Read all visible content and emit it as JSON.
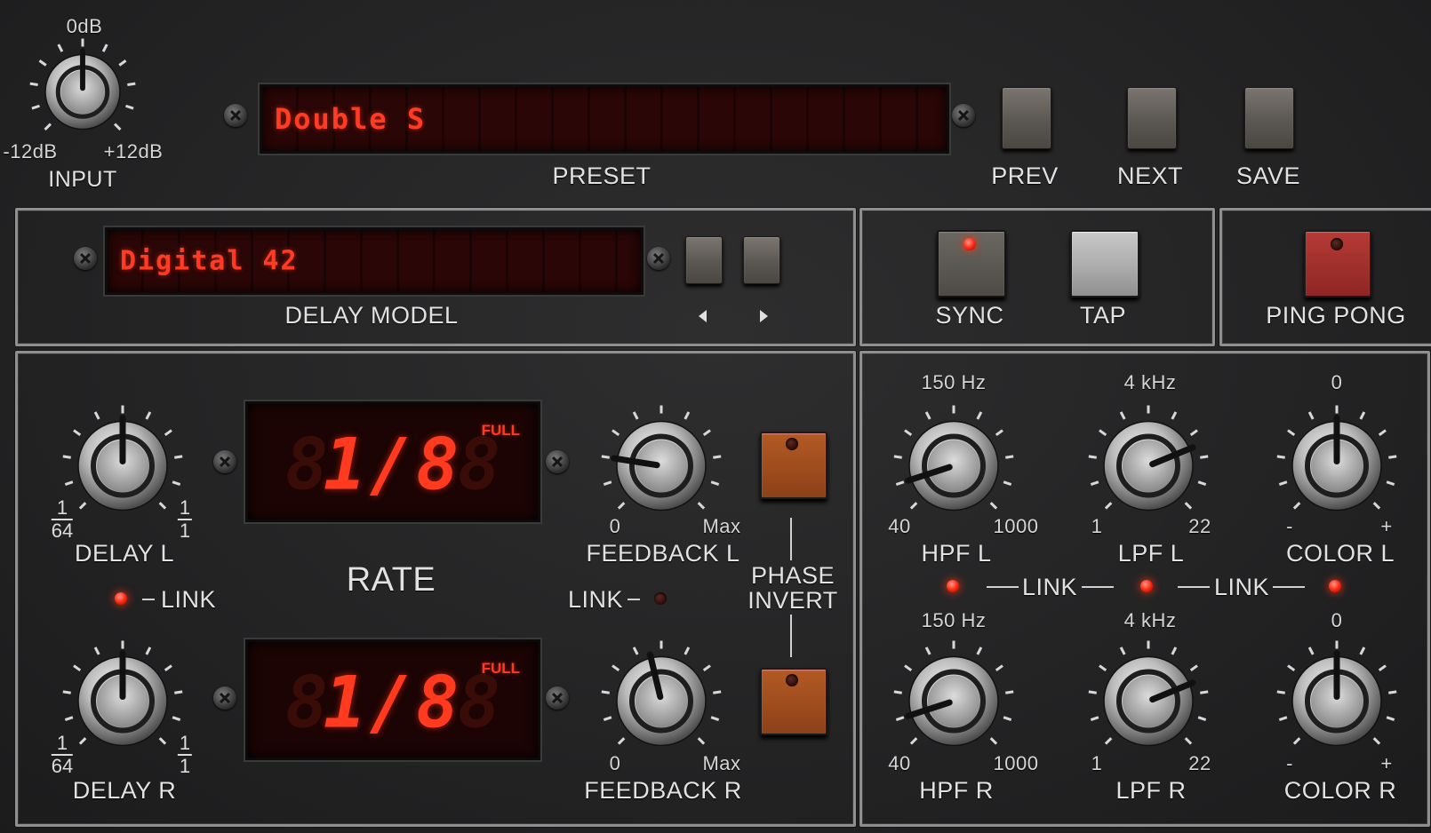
{
  "header": {
    "input": {
      "label": "INPUT",
      "top": "0dB",
      "min": "-12dB",
      "max": "+12dB",
      "value_fraction": 0.5
    },
    "preset": {
      "label": "PRESET",
      "value": "Double S"
    },
    "buttons": {
      "prev": "PREV",
      "next": "NEXT",
      "save": "SAVE"
    }
  },
  "model_section": {
    "label": "DELAY MODEL",
    "value": "Digital 42",
    "prev_arrow": "◀",
    "next_arrow": "▶"
  },
  "sync_section": {
    "sync": {
      "label": "SYNC",
      "led": "on"
    },
    "tap": {
      "label": "TAP"
    },
    "ping_pong": {
      "label": "PING PONG",
      "led": "off"
    }
  },
  "delay": {
    "delay_l": {
      "label": "DELAY L",
      "min_num": "1",
      "min_den": "64",
      "max_num": "1",
      "max_den": "1",
      "value_fraction": 0.5
    },
    "delay_r": {
      "label": "DELAY R",
      "min_num": "1",
      "min_den": "64",
      "max_num": "1",
      "max_den": "1",
      "value_fraction": 0.5
    },
    "link": {
      "label": "LINK",
      "led": "on"
    },
    "rate": {
      "label": "RATE",
      "top": {
        "value": "1/8",
        "mode": "FULL"
      },
      "bottom": {
        "value": "1/8",
        "mode": "FULL"
      }
    },
    "feedback_l": {
      "label": "FEEDBACK L",
      "min": "0",
      "max": "Max",
      "value_fraction": 0.2
    },
    "feedback_r": {
      "label": "FEEDBACK R",
      "min": "0",
      "max": "Max",
      "value_fraction": 0.45
    },
    "feedback_link": {
      "label": "LINK",
      "led": "off"
    },
    "phase_invert": {
      "line1": "PHASE",
      "line2": "INVERT"
    }
  },
  "filters": {
    "hpf_l": {
      "label": "HPF L",
      "top": "150 Hz",
      "min": "40",
      "max": "1000",
      "value_fraction": 0.1
    },
    "lpf_l": {
      "label": "LPF L",
      "top": "4 kHz",
      "min": "1",
      "max": "22",
      "value_fraction": 0.75
    },
    "color_l": {
      "label": "COLOR L",
      "top": "0",
      "min": "-",
      "max": "+",
      "value_fraction": 0.5
    },
    "hpf_r": {
      "label": "HPF R",
      "top": "150 Hz",
      "min": "40",
      "max": "1000",
      "value_fraction": 0.1
    },
    "lpf_r": {
      "label": "LPF R",
      "top": "4 kHz",
      "min": "1",
      "max": "22",
      "value_fraction": 0.75
    },
    "color_r": {
      "label": "COLOR R",
      "top": "0",
      "min": "-",
      "max": "+",
      "value_fraction": 0.5
    },
    "link_1": {
      "label": "LINK",
      "led": "on"
    },
    "link_2": {
      "label": "LINK",
      "led": "on"
    },
    "link_3_led": "on"
  }
}
